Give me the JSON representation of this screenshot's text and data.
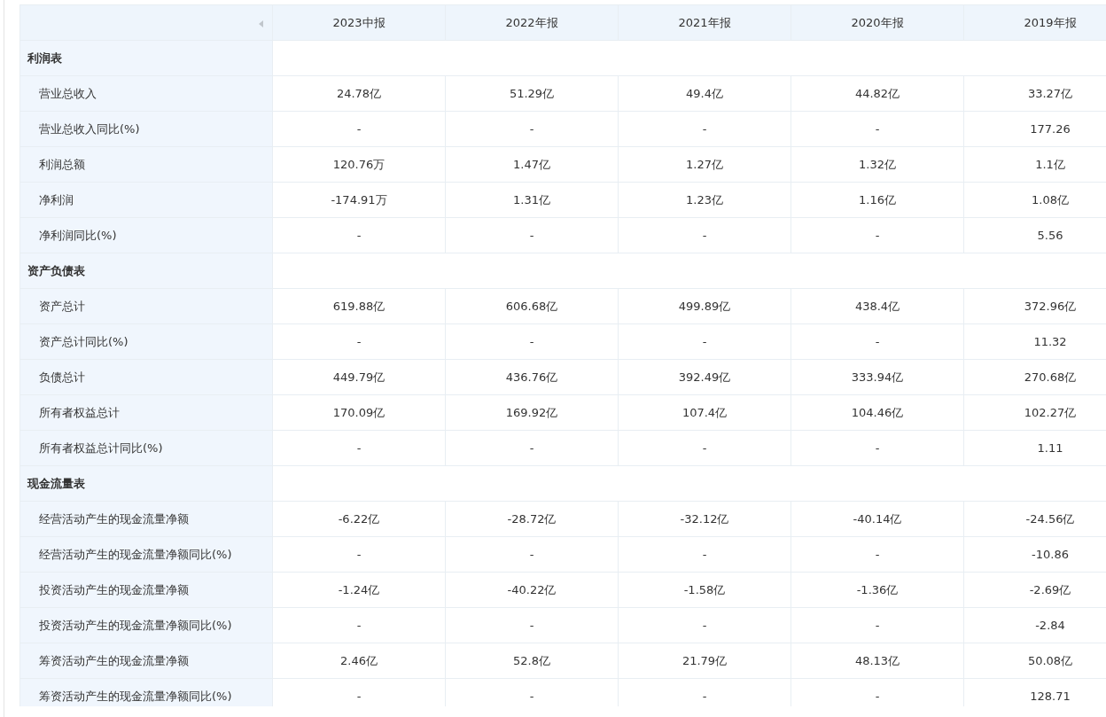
{
  "table": {
    "columns": [
      "2023中报",
      "2022年报",
      "2021年报",
      "2020年报",
      "2019年报"
    ],
    "sections": [
      {
        "title": "利润表",
        "rows": [
          {
            "label": "营业总收入",
            "values": [
              "24.78亿",
              "51.29亿",
              "49.4亿",
              "44.82亿",
              "33.27亿"
            ]
          },
          {
            "label": "营业总收入同比(%)",
            "values": [
              "-",
              "-",
              "-",
              "-",
              "177.26"
            ]
          },
          {
            "label": "利润总额",
            "values": [
              "120.76万",
              "1.47亿",
              "1.27亿",
              "1.32亿",
              "1.1亿"
            ]
          },
          {
            "label": "净利润",
            "values": [
              "-174.91万",
              "1.31亿",
              "1.23亿",
              "1.16亿",
              "1.08亿"
            ]
          },
          {
            "label": "净利润同比(%)",
            "values": [
              "-",
              "-",
              "-",
              "-",
              "5.56"
            ]
          }
        ]
      },
      {
        "title": "资产负债表",
        "rows": [
          {
            "label": "资产总计",
            "values": [
              "619.88亿",
              "606.68亿",
              "499.89亿",
              "438.4亿",
              "372.96亿"
            ]
          },
          {
            "label": "资产总计同比(%)",
            "values": [
              "-",
              "-",
              "-",
              "-",
              "11.32"
            ]
          },
          {
            "label": "负债总计",
            "values": [
              "449.79亿",
              "436.76亿",
              "392.49亿",
              "333.94亿",
              "270.68亿"
            ]
          },
          {
            "label": "所有者权益总计",
            "values": [
              "170.09亿",
              "169.92亿",
              "107.4亿",
              "104.46亿",
              "102.27亿"
            ]
          },
          {
            "label": "所有者权益总计同比(%)",
            "values": [
              "-",
              "-",
              "-",
              "-",
              "1.11"
            ]
          }
        ]
      },
      {
        "title": "现金流量表",
        "rows": [
          {
            "label": "经营活动产生的现金流量净额",
            "values": [
              "-6.22亿",
              "-28.72亿",
              "-32.12亿",
              "-40.14亿",
              "-24.56亿"
            ]
          },
          {
            "label": "经营活动产生的现金流量净额同比(%)",
            "values": [
              "-",
              "-",
              "-",
              "-",
              "-10.86"
            ]
          },
          {
            "label": "投资活动产生的现金流量净额",
            "values": [
              "-1.24亿",
              "-40.22亿",
              "-1.58亿",
              "-1.36亿",
              "-2.69亿"
            ]
          },
          {
            "label": "投资活动产生的现金流量净额同比(%)",
            "values": [
              "-",
              "-",
              "-",
              "-",
              "-2.84"
            ]
          },
          {
            "label": "筹资活动产生的现金流量净额",
            "values": [
              "2.46亿",
              "52.8亿",
              "21.79亿",
              "48.13亿",
              "50.08亿"
            ]
          },
          {
            "label": "筹资活动产生的现金流量净额同比(%)",
            "values": [
              "-",
              "-",
              "-",
              "-",
              "128.71"
            ]
          }
        ]
      }
    ]
  }
}
